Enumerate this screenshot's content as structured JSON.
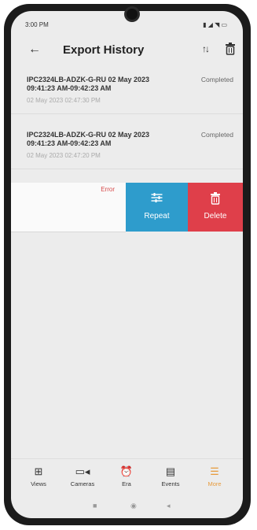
{
  "status_bar": {
    "time": "3:00 PM",
    "right_icons": "▮ ◢ ◥ ▭"
  },
  "app_bar": {
    "title": "Export History"
  },
  "items": [
    {
      "name": "IPC2324LB-ADZK-G-RU 02 May 2023 09:41:23 AM-09:42:23 AM",
      "status": "Completed",
      "time": "02 May 2023 02:47:30 PM"
    },
    {
      "name": "IPC2324LB-ADZK-G-RU 02 May 2023 09:41:23 AM-09:42:23 AM",
      "status": "Completed",
      "time": "02 May 2023 02:47:20 PM"
    }
  ],
  "swiped_item": {
    "status": "Error",
    "repeat_label": "Repeat",
    "delete_label": "Delete"
  },
  "bottom_nav": [
    {
      "label": "Views",
      "icon": "grid-icon"
    },
    {
      "label": "Cameras",
      "icon": "camera-icon"
    },
    {
      "label": "Era",
      "icon": "alarm-clock-icon"
    },
    {
      "label": "Events",
      "icon": "events-icon"
    },
    {
      "label": "More",
      "icon": "menu-icon",
      "active": true
    }
  ],
  "colors": {
    "repeat": "#2e9ccc",
    "delete": "#df3f4a",
    "accent": "#e79b3d",
    "error": "#d64a4a"
  }
}
